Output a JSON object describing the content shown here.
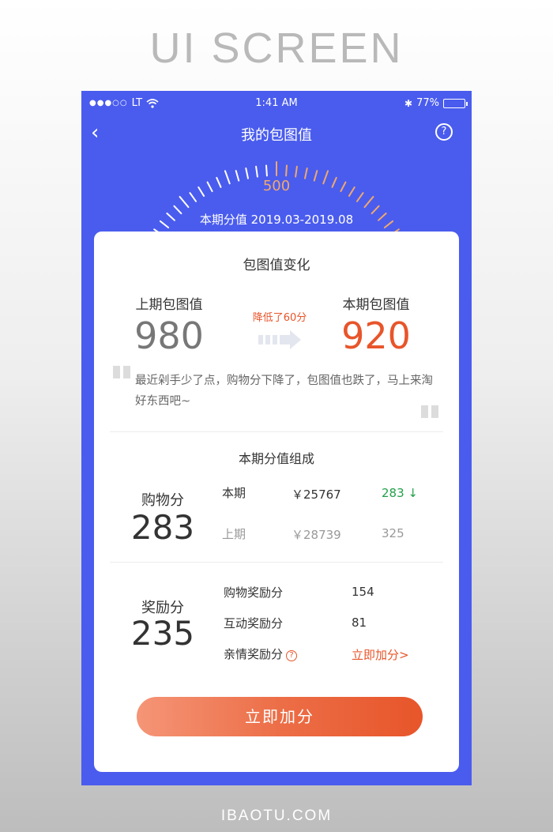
{
  "heading": "UI SCREEN",
  "footer": "IBAOTU.COM",
  "status": {
    "signal": "●●●○○",
    "carrier": "LT",
    "time": "1:41 AM",
    "bluetooth": "✱",
    "battery": "77%",
    "battery_level": 0.77
  },
  "nav": {
    "back": "‹",
    "title": "我的包图值",
    "help": "?"
  },
  "gauge": {
    "score": "500",
    "period": "本期分值 2019.03-2019.08"
  },
  "card": {
    "title": "包图值变化",
    "prev_label": "上期包图值",
    "prev_value": "980",
    "cur_label": "本期包图值",
    "cur_value": "920",
    "change": "降低了60分",
    "message": "最近剁手少了点，购物分下降了，包图值也跌了，马上来淘好东西吧~",
    "comp_title": "本期分值组成",
    "shopping": {
      "label": "购物分",
      "value": "283",
      "current_label": "本期",
      "current_amount": "￥25767",
      "current_score": "283",
      "trend_arrow": "↓",
      "previous_label": "上期",
      "previous_amount": "￥28739",
      "previous_score": "325"
    },
    "reward": {
      "label": "奖励分",
      "value": "235",
      "items": [
        {
          "name": "购物奖励分",
          "value": "154"
        },
        {
          "name": "互动奖励分",
          "value": "81"
        },
        {
          "name": "亲情奖励分",
          "value": "立即加分>"
        }
      ],
      "help": "?"
    },
    "button": "立即加分"
  },
  "colors": {
    "primary": "#4a5cee",
    "accent": "#e8552a",
    "gauge_tick": "#f0a86d",
    "trend_green": "#22a049"
  }
}
